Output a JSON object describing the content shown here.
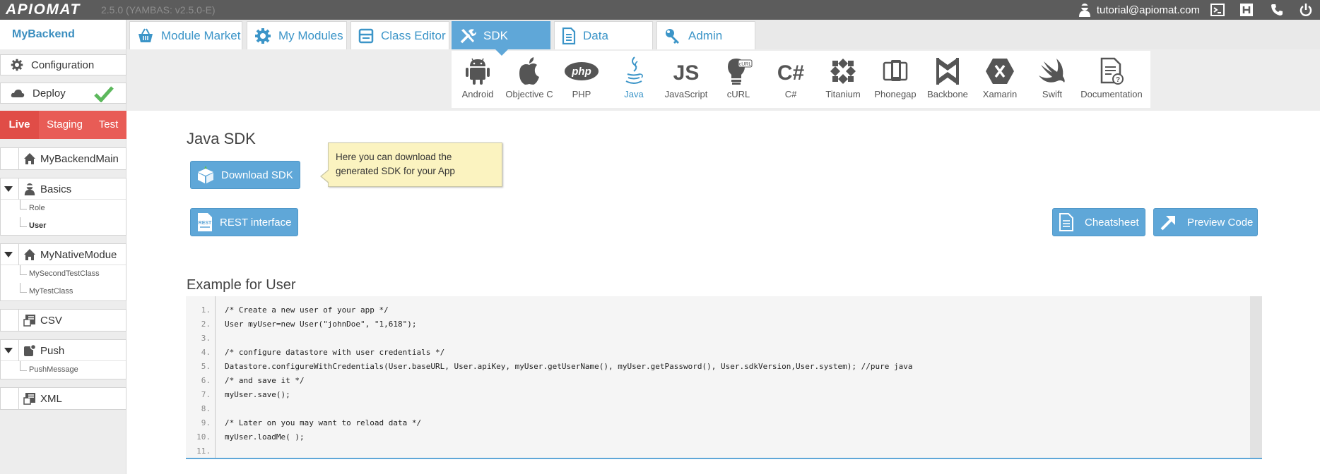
{
  "app": {
    "logo": "APIOMAT",
    "version": "2.5.0 (YAMBAS: v2.5.0-E)",
    "user_email": "tutorial@apiomat.com",
    "top_icons": [
      "terminal-icon",
      "h-icon",
      "phone-icon",
      "power-icon"
    ]
  },
  "nav": {
    "backend_name": "MyBackend",
    "tabs": [
      {
        "label": "Module Market",
        "icon": "basket-icon"
      },
      {
        "label": "My Modules",
        "icon": "gear-icon"
      },
      {
        "label": "Class Editor",
        "icon": "window-icon"
      },
      {
        "label": "SDK",
        "icon": "tools-icon",
        "active": true
      },
      {
        "label": "Data",
        "icon": "document-icon"
      },
      {
        "label": "Admin",
        "icon": "key-icon"
      }
    ]
  },
  "sdk_platforms": [
    {
      "label": "Android"
    },
    {
      "label": "Objective C"
    },
    {
      "label": "PHP"
    },
    {
      "label": "Java",
      "active": true
    },
    {
      "label": "JavaScript"
    },
    {
      "label": "cURL"
    },
    {
      "label": "C#"
    },
    {
      "label": "Titanium"
    },
    {
      "label": "Phonegap"
    },
    {
      "label": "Backbone"
    },
    {
      "label": "Xamarin"
    },
    {
      "label": "Swift"
    },
    {
      "label": "Documentation"
    }
  ],
  "sidebar": {
    "configuration": "Configuration",
    "deploy": "Deploy",
    "environments": [
      "Live",
      "Staging",
      "Test"
    ],
    "active_environment": "Live",
    "main_module": "MyBackendMain",
    "groups": [
      {
        "label": "Basics",
        "items": [
          "Role",
          "User"
        ],
        "selected": "User"
      },
      {
        "label": "MyNativeModue",
        "items": [
          "MySecondTestClass",
          "MyTestClass"
        ]
      },
      {
        "label": "CSV",
        "items": []
      },
      {
        "label": "Push",
        "items": [
          "PushMessage"
        ]
      },
      {
        "label": "XML",
        "items": []
      }
    ]
  },
  "main": {
    "title": "Java SDK",
    "download_button": "Download SDK",
    "rest_button": "REST interface",
    "cheatsheet_button": "Cheatsheet",
    "preview_button": "Preview Code",
    "tooltip": "Here you can download the generated SDK for your App",
    "example_title": "Example for User"
  },
  "code": {
    "line_numbers": [
      "1.",
      "2.",
      "3.",
      "4.",
      "5.",
      "6.",
      "7.",
      "8.",
      "9.",
      "10.",
      "11."
    ],
    "lines": [
      "/* Create a new user of your app */",
      "User myUser=new User(\"johnDoe\", \"1,618\");",
      "",
      "/* configure datastore with user credentials */",
      "Datastore.configureWithCredentials(User.baseURL, User.apiKey, myUser.getUserName(), myUser.getPassword(), User.sdkVersion,User.system); //pure java",
      "/* and save it */",
      "myUser.save();",
      "",
      "/* Later on you may want to reload data */",
      "myUser.loadMe( );",
      ""
    ]
  },
  "colors": {
    "accent_blue": "#5fa7d8",
    "env_red": "#e85c56",
    "deploy_check": "#5cb85c",
    "tooltip_bg": "#fbf3c0"
  }
}
